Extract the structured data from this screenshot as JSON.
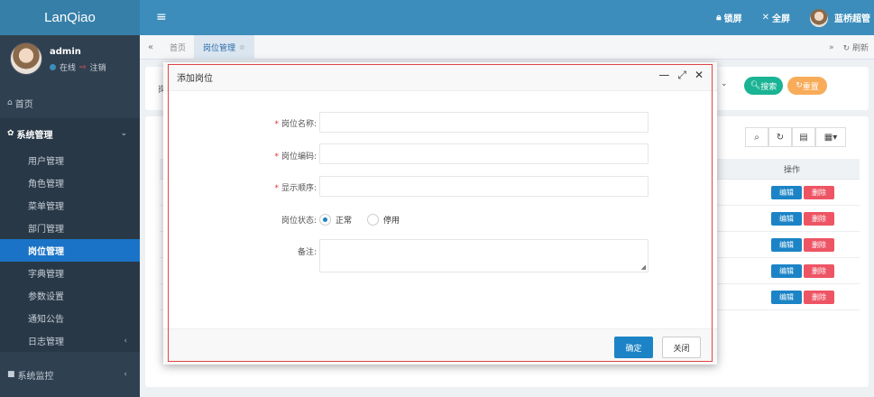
{
  "app": {
    "logo": "LanQiao"
  },
  "user": {
    "name": "admin",
    "status": "在线",
    "logout": "注销"
  },
  "sidebar": {
    "home": "首页",
    "system_group": "系统管理",
    "items": [
      "用户管理",
      "角色管理",
      "菜单管理",
      "部门管理",
      "岗位管理",
      "字典管理",
      "参数设置",
      "通知公告",
      "日志管理"
    ],
    "monitor_group": "系统监控",
    "active_item": "岗位管理"
  },
  "header": {
    "menu_icon": "≡",
    "lock": "锁屏",
    "fullscreen": "全屏",
    "admin_name": "蓝桥超管"
  },
  "tabs": {
    "items": [
      {
        "label": "首页"
      },
      {
        "label": "岗位管理"
      }
    ],
    "refresh": "刷新"
  },
  "search": {
    "search_btn": "搜索",
    "reset_btn": "重置"
  },
  "table": {
    "op_header": "操作",
    "rows": [
      {
        "edit": "编辑",
        "del": "删除"
      },
      {
        "edit": "编辑",
        "del": "删除"
      },
      {
        "edit": "编辑",
        "del": "删除"
      },
      {
        "edit": "编辑",
        "del": "删除"
      },
      {
        "edit": "编辑",
        "del": "删除"
      }
    ],
    "left_char_top": "岗",
    "left_char_bottom": "显"
  },
  "modal": {
    "title": "添加岗位",
    "fields": {
      "name_label": "岗位名称:",
      "code_label": "岗位编码:",
      "order_label": "显示顺序:",
      "status_label": "岗位状态:",
      "remark_label": "备注:"
    },
    "status_options": {
      "normal": "正常",
      "disabled": "停用",
      "selected": "正常"
    },
    "ok_btn": "确定",
    "close_btn": "关闭"
  },
  "colors": {
    "header": "#3c8dbc",
    "sidebar": "#2f4050",
    "primary": "#1c84c6",
    "danger": "#ed5565",
    "success": "#1ab394",
    "warning": "#f8ac59",
    "highlight_frame": "#e24343"
  }
}
